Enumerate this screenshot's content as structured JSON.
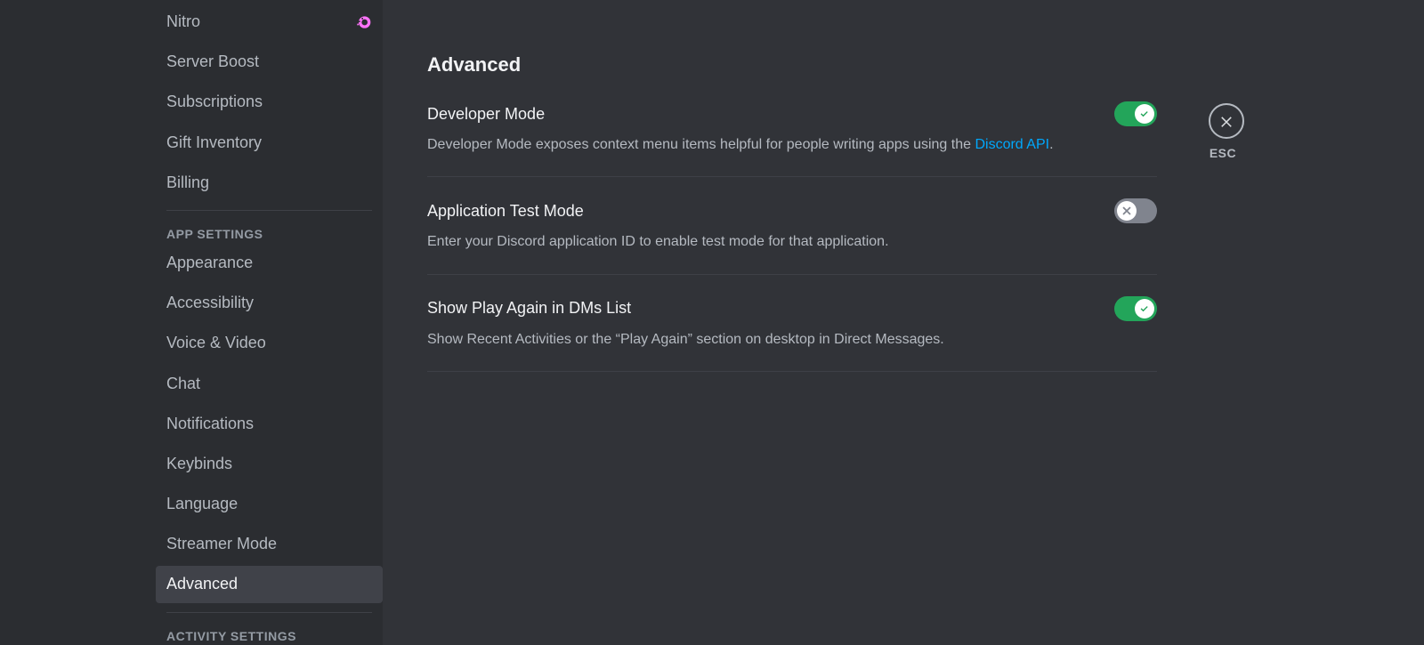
{
  "sidebar": {
    "billing_items": [
      {
        "label": "Nitro",
        "has_icon": true
      },
      {
        "label": "Server Boost"
      },
      {
        "label": "Subscriptions"
      },
      {
        "label": "Gift Inventory"
      },
      {
        "label": "Billing"
      }
    ],
    "app_header": "APP SETTINGS",
    "app_items": [
      {
        "label": "Appearance"
      },
      {
        "label": "Accessibility"
      },
      {
        "label": "Voice & Video"
      },
      {
        "label": "Chat"
      },
      {
        "label": "Notifications"
      },
      {
        "label": "Keybinds"
      },
      {
        "label": "Language"
      },
      {
        "label": "Streamer Mode"
      },
      {
        "label": "Advanced",
        "selected": true
      }
    ],
    "activity_header": "ACTIVITY SETTINGS"
  },
  "content": {
    "title": "Advanced",
    "settings": [
      {
        "title": "Developer Mode",
        "desc_pre": "Developer Mode exposes context menu items helpful for people writing apps using the ",
        "link_text": "Discord API",
        "desc_post": ".",
        "on": true
      },
      {
        "title": "Application Test Mode",
        "desc_pre": "Enter your Discord application ID to enable test mode for that application.",
        "link_text": "",
        "desc_post": "",
        "on": false
      },
      {
        "title": "Show Play Again in DMs List",
        "desc_pre": "Show Recent Activities or the “Play Again” section on desktop in Direct Messages.",
        "link_text": "",
        "desc_post": "",
        "on": true
      }
    ]
  },
  "close": {
    "label": "ESC"
  }
}
